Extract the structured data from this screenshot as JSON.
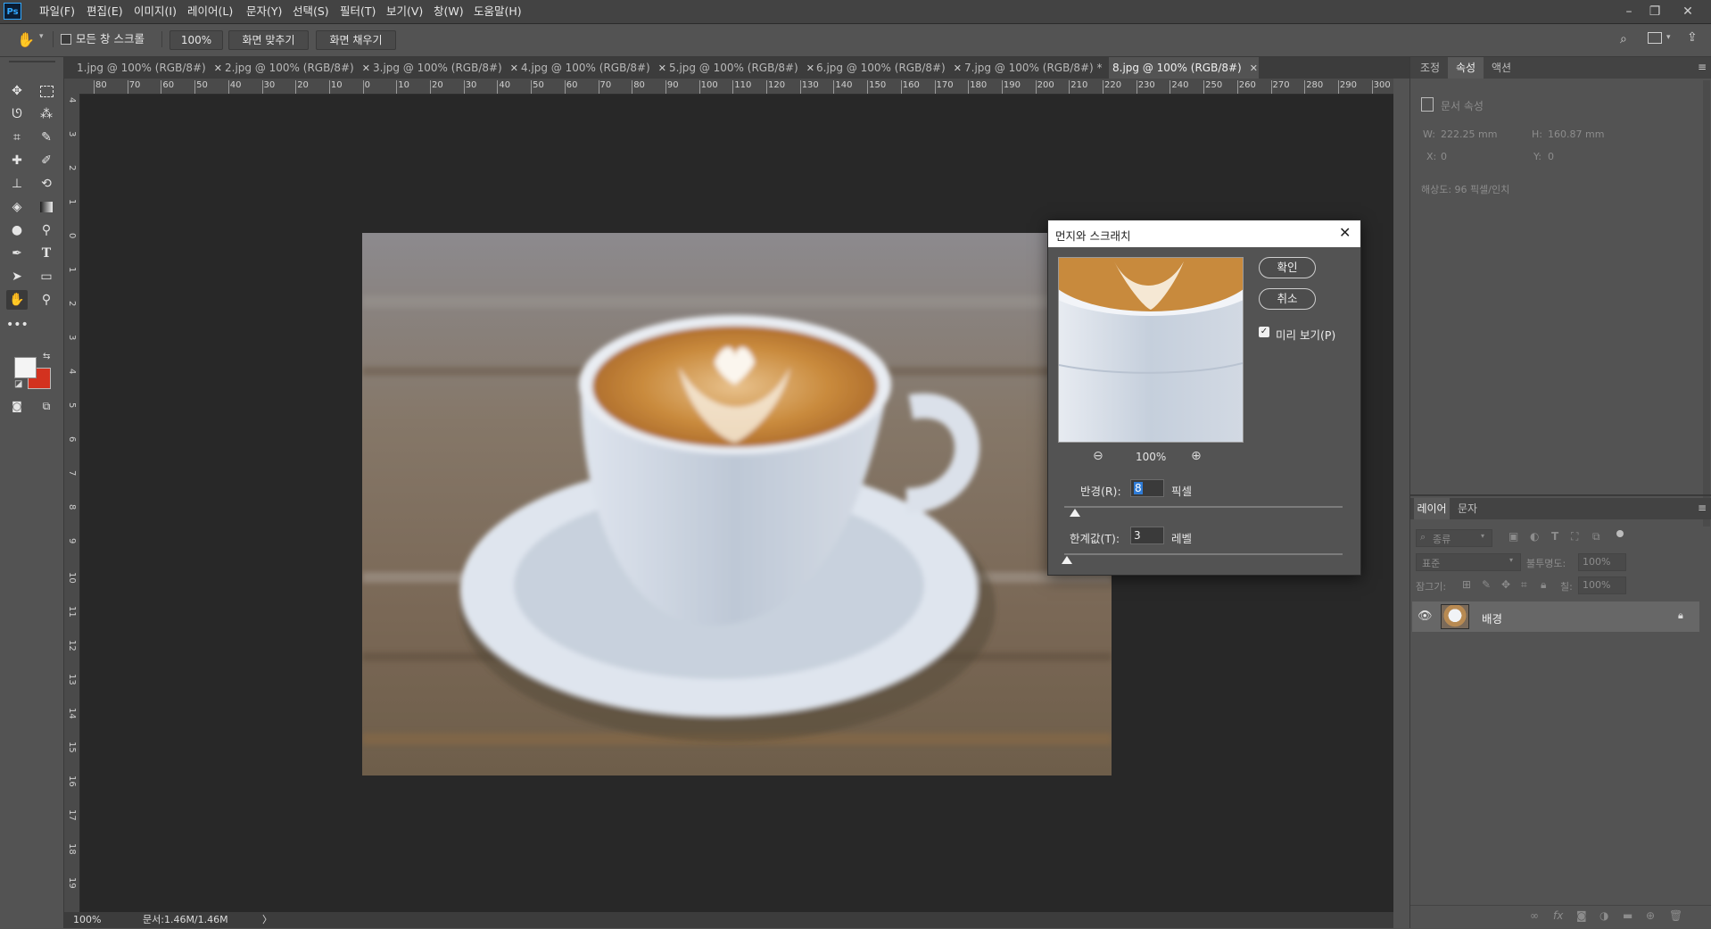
{
  "app": {
    "logo": "Ps"
  },
  "menu": [
    "파일(F)",
    "편집(E)",
    "이미지(I)",
    "레이어(L)",
    "문자(Y)",
    "선택(S)",
    "필터(T)",
    "보기(V)",
    "창(W)",
    "도움말(H)"
  ],
  "options": {
    "scroll_all_label": "모든 창 스크롤",
    "zoom_value": "100%",
    "fit_screen": "화면 맞추기",
    "fill_screen": "화면 채우기"
  },
  "tabs": [
    {
      "label": "1.jpg @ 100% (RGB/8#)",
      "active": false
    },
    {
      "label": "2.jpg @ 100% (RGB/8#)",
      "active": false
    },
    {
      "label": "3.jpg @ 100% (RGB/8#)",
      "active": false
    },
    {
      "label": "4.jpg @ 100% (RGB/8#)",
      "active": false
    },
    {
      "label": "5.jpg @ 100% (RGB/8#)",
      "active": false
    },
    {
      "label": "6.jpg @ 100% (RGB/8#)",
      "active": false
    },
    {
      "label": "7.jpg @ 100% (RGB/8#) *",
      "active": false
    },
    {
      "label": "8.jpg @ 100% (RGB/8#)",
      "active": true
    }
  ],
  "ruler": {
    "h": [
      "80",
      "70",
      "60",
      "50",
      "40",
      "30",
      "20",
      "10",
      "0",
      "10",
      "20",
      "30",
      "40",
      "50",
      "60",
      "70",
      "80",
      "90",
      "100",
      "110",
      "120",
      "130",
      "140",
      "150",
      "160",
      "170",
      "180",
      "190",
      "200",
      "210",
      "220",
      "230",
      "240",
      "250",
      "260",
      "270",
      "280",
      "290",
      "300"
    ],
    "v": [
      "4",
      "3",
      "2",
      "1",
      "0",
      "1",
      "2",
      "3",
      "4",
      "5",
      "6",
      "7",
      "8",
      "9",
      "10",
      "11",
      "12",
      "13",
      "14",
      "15",
      "16",
      "17",
      "18",
      "19"
    ]
  },
  "status": {
    "zoom": "100%",
    "doc": "문서:1.46M/1.46M",
    "arrow": "〉"
  },
  "properties_panel": {
    "tabs": [
      "조정",
      "속성",
      "액션"
    ],
    "active_tab": "속성",
    "header": "문서 속성",
    "w_label": "W:",
    "w_value": "222.25 mm",
    "h_label": "H:",
    "h_value": "160.87 mm",
    "x_label": "X:",
    "x_value": "0",
    "y_label": "Y:",
    "y_value": "0",
    "resolution": "해상도: 96 픽셀/인치"
  },
  "layers_panel": {
    "tabs": [
      "레이어",
      "문자"
    ],
    "active_tab": "레이어",
    "filter_label": "종류",
    "blend_mode": "표준",
    "opacity_label": "불투명도:",
    "opacity_value": "100%",
    "lock_label": "잠그기:",
    "fill_label": "칠:",
    "fill_value": "100%",
    "layers": [
      {
        "name": "배경",
        "visible": true,
        "locked": true
      }
    ]
  },
  "dialog": {
    "title": "먼지와 스크래치",
    "ok": "확인",
    "cancel": "취소",
    "preview_label": "미리 보기(P)",
    "preview_checked": true,
    "preview_zoom": "100%",
    "radius_label": "반경(R):",
    "radius_value": "8",
    "radius_unit": "픽셀",
    "radius_slider": 0.04,
    "threshold_label": "한계값(T):",
    "threshold_value": "3",
    "threshold_unit": "레벨",
    "threshold_slider": 0.01
  },
  "colors": {
    "foreground": "#f4f4f4",
    "background": "#d3321f",
    "accent": "#31a8ff"
  }
}
